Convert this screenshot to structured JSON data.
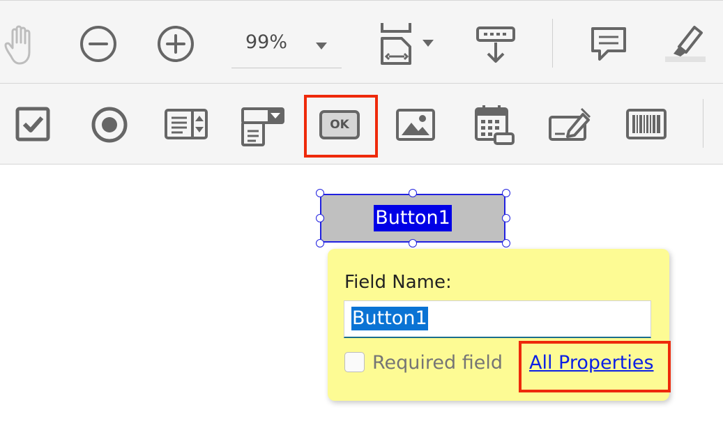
{
  "toolbar_top": {
    "icons": [
      "hand-tool-icon",
      "zoom-out-icon",
      "zoom-in-icon",
      "fit-page-icon",
      "scroll-mode-icon",
      "comment-icon",
      "highlight-icon"
    ],
    "zoom_value": "99%",
    "colors": {
      "icon": "#666666",
      "background": "#f5f5f5"
    }
  },
  "toolbar_forms": {
    "icons": [
      "checkbox-tool-icon",
      "radio-tool-icon",
      "list-box-tool-icon",
      "dropdown-tool-icon",
      "button-tool-icon",
      "image-field-tool-icon",
      "date-field-tool-icon",
      "signature-field-tool-icon",
      "barcode-tool-icon"
    ],
    "button_icon_text": "OK",
    "highlight_color": "#ee2a0b"
  },
  "field": {
    "label": "Button1"
  },
  "popup": {
    "field_name_label": "Field Name:",
    "field_name_value": "Button1",
    "required_label": "Required field",
    "required_checked": false,
    "all_properties_link": "All Properties",
    "background": "#fdfb94"
  }
}
